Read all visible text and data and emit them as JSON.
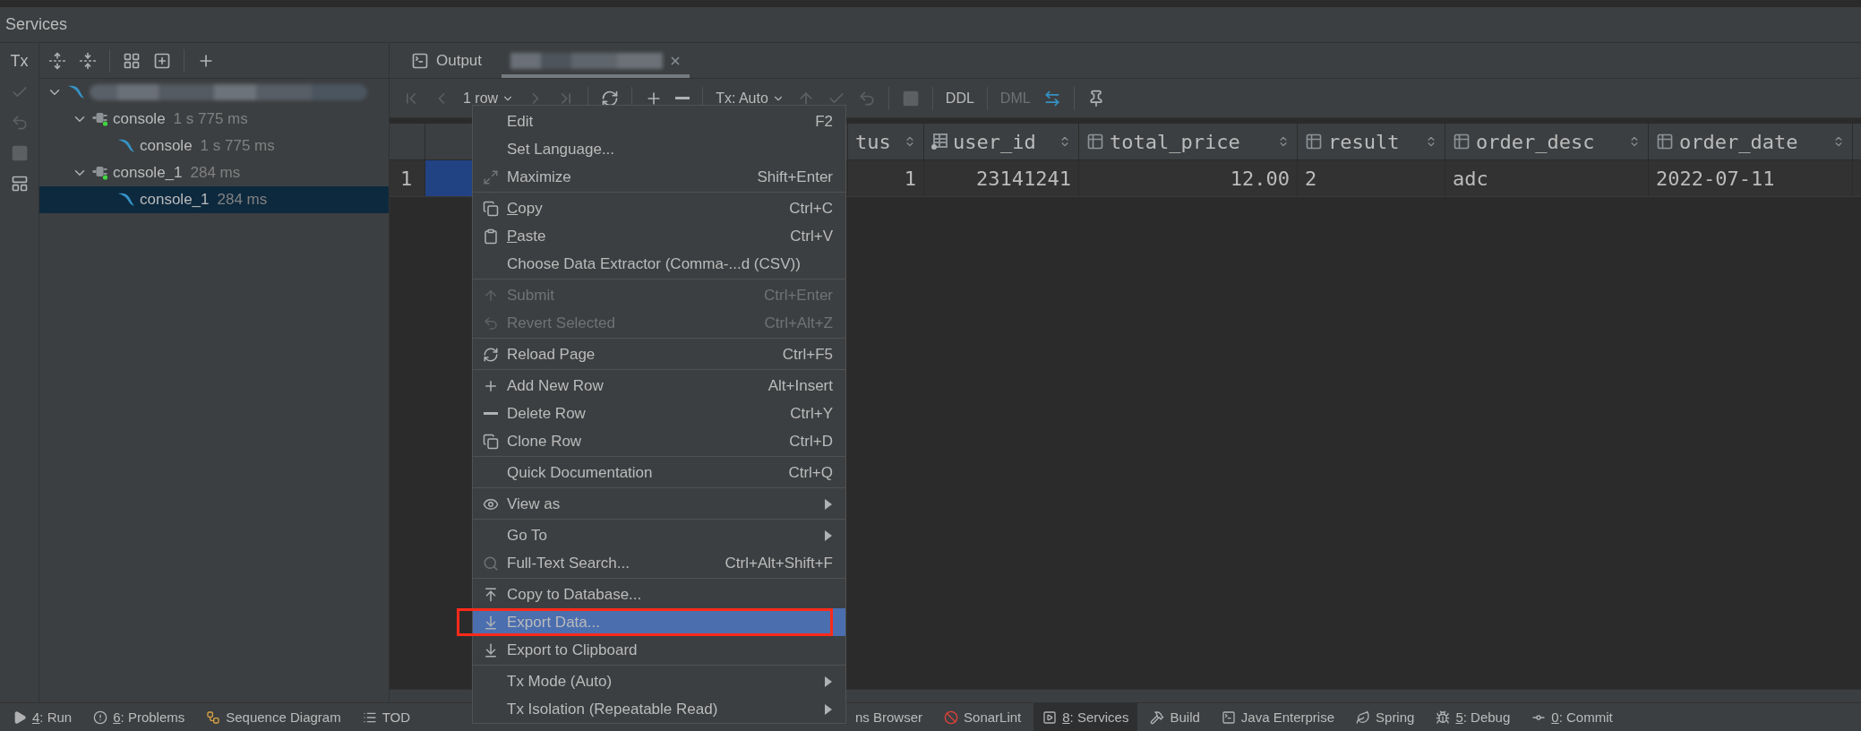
{
  "header": {
    "title": "Services"
  },
  "side_toolbar": [
    {
      "kind": "tx",
      "label": "Tx",
      "disabled": false
    },
    {
      "kind": "commit",
      "disabled": true
    },
    {
      "kind": "rollback",
      "disabled": true
    },
    {
      "kind": "stop",
      "disabled": true
    },
    {
      "kind": "layout",
      "disabled": false
    }
  ],
  "services_toolbar": [
    {
      "kind": "expand-all"
    },
    {
      "kind": "collapse-all"
    },
    {
      "kind": "separator"
    },
    {
      "kind": "group"
    },
    {
      "kind": "add-service"
    },
    {
      "kind": "separator"
    },
    {
      "kind": "add"
    }
  ],
  "tree": [
    {
      "kind": "datasource",
      "selected": false,
      "expanded": true,
      "children": [
        {
          "kind": "session",
          "label": "console",
          "time": "1 s 775 ms",
          "selected": false,
          "expanded": true,
          "children": [
            {
              "kind": "console",
              "label": "console",
              "time": "1 s 775 ms",
              "selected": false
            }
          ]
        },
        {
          "kind": "session",
          "label": "console_1",
          "time": "284 ms",
          "selected": false,
          "expanded": true,
          "children": [
            {
              "kind": "console",
              "label": "console_1",
              "time": "284 ms",
              "selected": true
            }
          ]
        }
      ]
    }
  ],
  "tabs": [
    {
      "kind": "output",
      "label": "Output",
      "selected": false
    },
    {
      "kind": "redacted",
      "selected": true
    }
  ],
  "result_toolbar": [
    {
      "kind": "first",
      "disabled": true
    },
    {
      "kind": "prev",
      "disabled": true
    },
    {
      "kind": "dropdown",
      "label": "1 row",
      "disabled": false
    },
    {
      "kind": "next",
      "disabled": true
    },
    {
      "kind": "last",
      "disabled": true
    },
    {
      "kind": "separator"
    },
    {
      "kind": "reload",
      "disabled": false
    },
    {
      "kind": "separator"
    },
    {
      "kind": "add",
      "disabled": false
    },
    {
      "kind": "remove",
      "disabled": false
    },
    {
      "kind": "separator"
    },
    {
      "kind": "dropdown",
      "label": "Tx: Auto",
      "disabled": false
    },
    {
      "kind": "submit",
      "disabled": true
    },
    {
      "kind": "commit",
      "disabled": true
    },
    {
      "kind": "rollback",
      "disabled": true
    },
    {
      "kind": "separator"
    },
    {
      "kind": "stop",
      "disabled": true
    },
    {
      "kind": "separator"
    },
    {
      "kind": "text",
      "label": "DDL",
      "disabled": false
    },
    {
      "kind": "separator"
    },
    {
      "kind": "text",
      "label": "DML",
      "disabled": true
    },
    {
      "kind": "compare",
      "disabled": false
    },
    {
      "kind": "separator"
    },
    {
      "kind": "pin",
      "disabled": false
    }
  ],
  "table": {
    "columns": [
      {
        "label": "tus",
        "kind": "number-plain"
      },
      {
        "label": "user_id",
        "kind": "number-indexed"
      },
      {
        "label": "total_price",
        "kind": "number"
      },
      {
        "label": "result",
        "kind": "text"
      },
      {
        "label": "order_desc",
        "kind": "text"
      },
      {
        "label": "order_date",
        "kind": "text"
      }
    ],
    "rows": [
      {
        "number": "1",
        "cursor_cell_selected": true,
        "cells": [
          "1",
          "23141241",
          "12.00",
          "2",
          "adc",
          "2022-07-11"
        ]
      }
    ]
  },
  "context_menu": {
    "groups": [
      [
        {
          "label": "Edit",
          "shortcut": "F2",
          "kind": "plain",
          "disabled": false,
          "selected": false,
          "submenu": false,
          "underline_first": false,
          "framed": false
        },
        {
          "label": "Set Language...",
          "kind": "plain",
          "disabled": false,
          "selected": false,
          "submenu": false,
          "underline_first": false,
          "framed": false
        },
        {
          "label": "Maximize",
          "shortcut": "Shift+Enter",
          "kind": "maximize",
          "disabled": false,
          "selected": false,
          "submenu": false,
          "underline_first": false,
          "framed": false
        }
      ],
      [
        {
          "label": "Copy",
          "shortcut": "Ctrl+C",
          "kind": "copy",
          "disabled": false,
          "selected": false,
          "submenu": false,
          "underline_first": true,
          "framed": false
        },
        {
          "label": "Paste",
          "shortcut": "Ctrl+V",
          "kind": "paste",
          "disabled": false,
          "selected": false,
          "submenu": false,
          "underline_first": true,
          "framed": false
        },
        {
          "label": "Choose Data Extractor (Comma-...d (CSV))",
          "kind": "plain",
          "disabled": false,
          "selected": false,
          "submenu": false,
          "underline_first": false,
          "framed": false
        }
      ],
      [
        {
          "label": "Submit",
          "shortcut": "Ctrl+Enter",
          "kind": "submit",
          "disabled": true,
          "selected": false,
          "submenu": false,
          "underline_first": false,
          "framed": false
        },
        {
          "label": "Revert Selected",
          "shortcut": "Ctrl+Alt+Z",
          "kind": "revert",
          "disabled": true,
          "selected": false,
          "submenu": false,
          "underline_first": false,
          "framed": false
        }
      ],
      [
        {
          "label": "Reload Page",
          "shortcut": "Ctrl+F5",
          "kind": "reload",
          "disabled": false,
          "selected": false,
          "submenu": false,
          "underline_first": false,
          "framed": false
        }
      ],
      [
        {
          "label": "Add New Row",
          "shortcut": "Alt+Insert",
          "kind": "add",
          "disabled": false,
          "selected": false,
          "submenu": false,
          "underline_first": false,
          "framed": false
        },
        {
          "label": "Delete Row",
          "shortcut": "Ctrl+Y",
          "kind": "delete",
          "disabled": false,
          "selected": false,
          "submenu": false,
          "underline_first": false,
          "framed": false
        },
        {
          "label": "Clone Row",
          "shortcut": "Ctrl+D",
          "kind": "clone",
          "disabled": false,
          "selected": false,
          "submenu": false,
          "underline_first": false,
          "framed": false
        }
      ],
      [
        {
          "label": "Quick Documentation",
          "shortcut": "Ctrl+Q",
          "kind": "plain",
          "disabled": false,
          "selected": false,
          "submenu": false,
          "underline_first": false,
          "framed": false
        }
      ],
      [
        {
          "label": "View as",
          "kind": "view",
          "disabled": false,
          "selected": false,
          "submenu": true,
          "underline_first": false,
          "framed": false
        }
      ],
      [
        {
          "label": "Go To",
          "kind": "plain",
          "disabled": false,
          "selected": false,
          "submenu": true,
          "underline_first": false,
          "framed": false
        },
        {
          "label": "Full-Text Search...",
          "shortcut": "Ctrl+Alt+Shift+F",
          "kind": "search",
          "disabled": false,
          "selected": false,
          "submenu": false,
          "underline_first": false,
          "framed": false
        }
      ],
      [
        {
          "label": "Copy to Database...",
          "kind": "copy-db",
          "disabled": false,
          "selected": false,
          "submenu": false,
          "underline_first": false,
          "framed": false
        },
        {
          "label": "Export Data...",
          "kind": "export",
          "disabled": false,
          "selected": true,
          "submenu": false,
          "underline_first": false,
          "framed": true
        },
        {
          "label": "Export to Clipboard",
          "kind": "export",
          "disabled": false,
          "selected": false,
          "submenu": false,
          "underline_first": false,
          "framed": false
        }
      ],
      [
        {
          "label": "Tx Mode (Auto)",
          "kind": "plain",
          "disabled": false,
          "selected": false,
          "submenu": true,
          "underline_first": false,
          "framed": false
        },
        {
          "label": "Tx Isolation (Repeatable Read)",
          "kind": "plain",
          "disabled": false,
          "selected": false,
          "submenu": true,
          "underline_first": false,
          "framed": false
        }
      ]
    ]
  },
  "status_bar": {
    "left": [
      {
        "label": "4: Run",
        "kind": "run",
        "selected": false,
        "underline_first": true
      },
      {
        "label": "6: Problems",
        "kind": "problems",
        "selected": false,
        "underline_first": true
      },
      {
        "label": "Sequence Diagram",
        "kind": "sequence",
        "selected": false,
        "underline_first": false
      },
      {
        "label": "TOD",
        "kind": "todo",
        "selected": false,
        "underline_first": false
      }
    ],
    "right": [
      {
        "label": "ns Browser",
        "kind": "plain",
        "selected": false,
        "underline_first": false
      },
      {
        "label": "SonarLint",
        "kind": "sonarlint",
        "selected": false,
        "underline_first": false
      },
      {
        "label": "8: Services",
        "kind": "services",
        "selected": true,
        "underline_first": true
      },
      {
        "label": "Build",
        "kind": "build",
        "selected": false,
        "underline_first": false
      },
      {
        "label": "Java Enterprise",
        "kind": "java-enterprise",
        "selected": false,
        "underline_first": false
      },
      {
        "label": "Spring",
        "kind": "spring",
        "selected": false,
        "underline_first": false
      },
      {
        "label": "5: Debug",
        "kind": "debug",
        "selected": false,
        "underline_first": true
      },
      {
        "label": "0: Commit",
        "kind": "commit",
        "selected": false,
        "underline_first": true
      }
    ]
  }
}
